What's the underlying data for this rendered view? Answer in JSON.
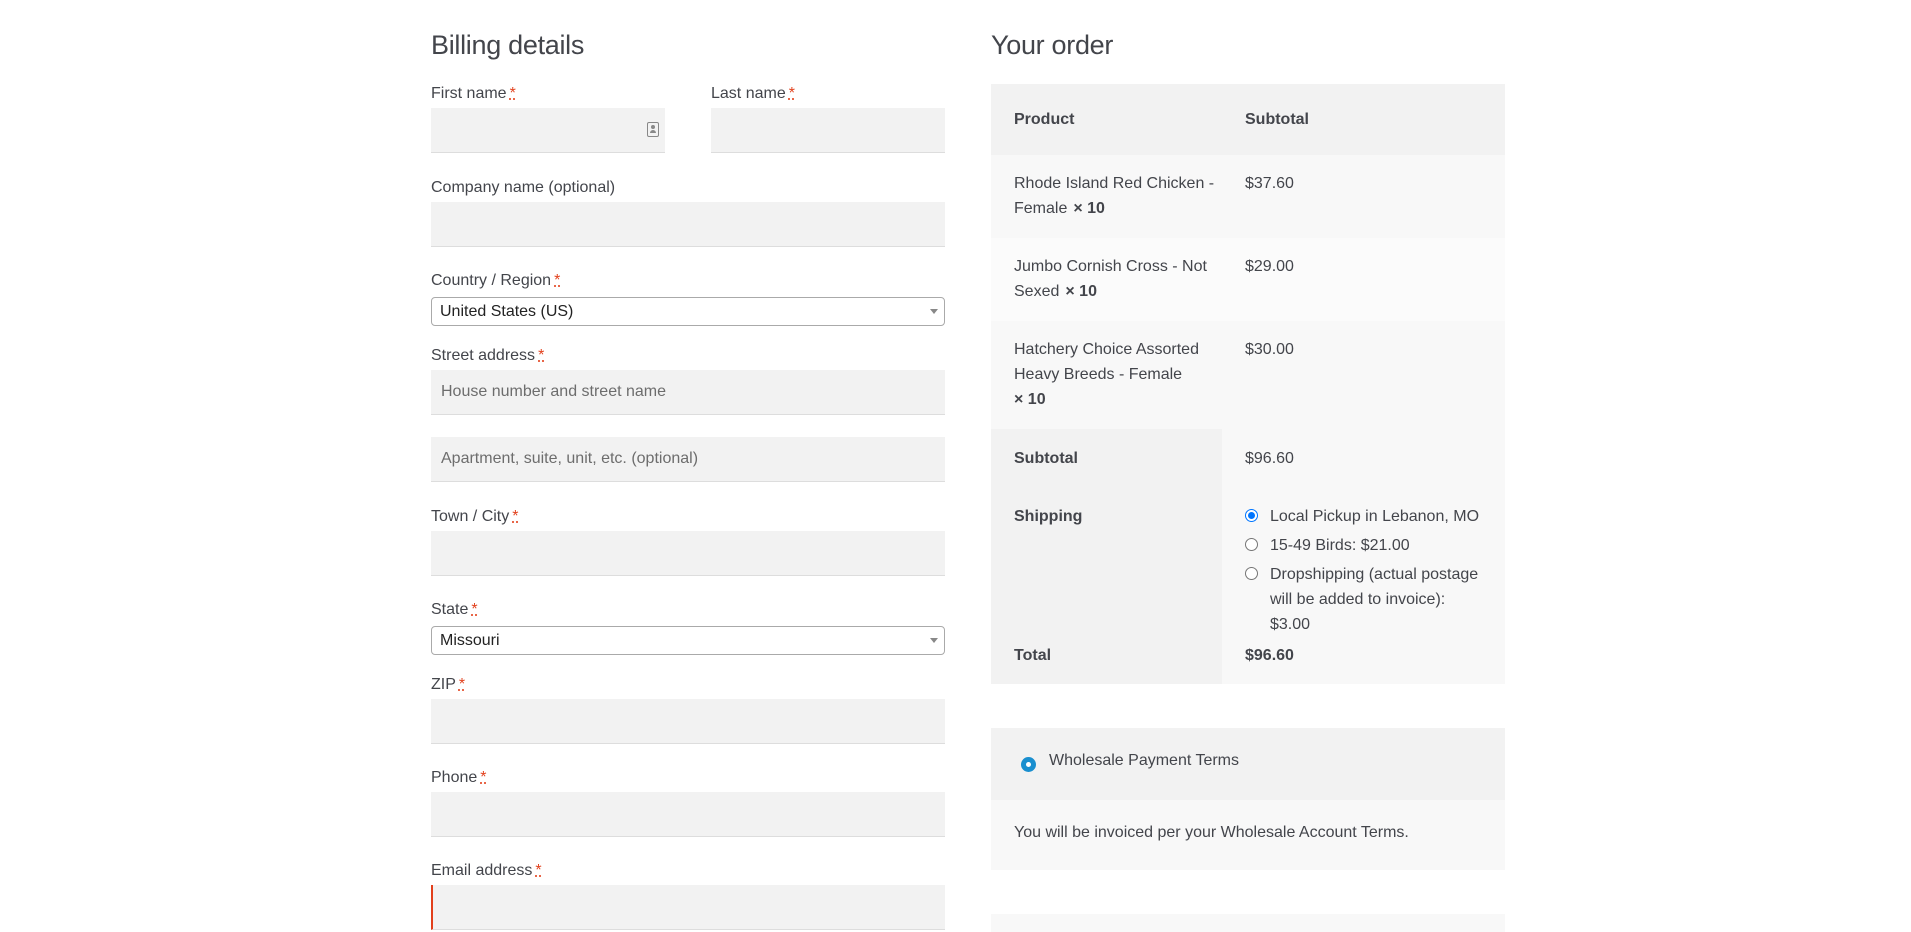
{
  "billing": {
    "title": "Billing details",
    "required_mark": "*",
    "first_name": {
      "label": "First name",
      "value": "",
      "placeholder": ""
    },
    "last_name": {
      "label": "Last name",
      "value": "",
      "placeholder": ""
    },
    "company": {
      "label": "Company name (optional)",
      "value": "",
      "placeholder": ""
    },
    "country": {
      "label": "Country / Region",
      "value": "United States (US)"
    },
    "street": {
      "label": "Street address",
      "placeholder_1": "House number and street name",
      "placeholder_2": "Apartment, suite, unit, etc. (optional)"
    },
    "city": {
      "label": "Town / City",
      "value": ""
    },
    "state": {
      "label": "State",
      "value": "Missouri"
    },
    "zip": {
      "label": "ZIP",
      "value": ""
    },
    "phone": {
      "label": "Phone",
      "value": ""
    },
    "email": {
      "label": "Email address",
      "value": ""
    }
  },
  "order": {
    "title": "Your order",
    "header": {
      "product": "Product",
      "subtotal": "Subtotal"
    },
    "items": [
      {
        "name_line1": "Rhode Island Red Chicken -",
        "name_line2": "Female",
        "qty": "× 10",
        "price": "$37.60"
      },
      {
        "name_line1": "Jumbo Cornish Cross - Not",
        "name_line2": "Sexed",
        "qty": "× 10",
        "price": "$29.00"
      },
      {
        "name_line1": "Hatchery Choice Assorted",
        "name_line2": "Heavy Breeds - Female",
        "qty": "× 10",
        "price": "$30.00"
      }
    ],
    "subtotal": {
      "label": "Subtotal",
      "value": "$96.60"
    },
    "shipping": {
      "label": "Shipping",
      "options": [
        {
          "label": "Local Pickup in Lebanon, MO",
          "checked": true
        },
        {
          "label": "15-49 Birds: $21.00",
          "checked": false
        },
        {
          "label": "Dropshipping (actual postage will be added to invoice): $3.00",
          "checked": false
        }
      ]
    },
    "total": {
      "label": "Total",
      "value": "$96.60"
    }
  },
  "payment": {
    "method_label": "Wholesale Payment Terms",
    "description": "You will be invoiced per your Wholesale Account Terms."
  },
  "colors": {
    "required": "#e2401c",
    "field_bg": "#f2f2f2",
    "radio_accent": "#0075ff",
    "payment_radio": "#1a8fcf"
  }
}
